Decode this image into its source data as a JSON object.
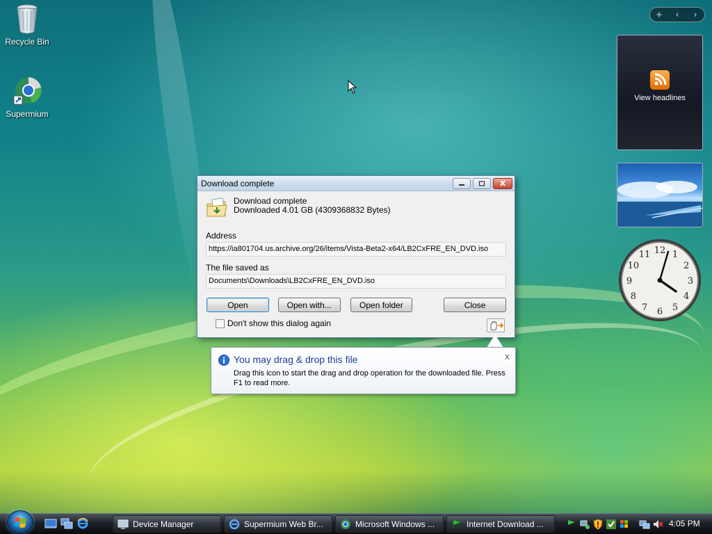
{
  "desktop": {
    "icons": [
      {
        "label": "Recycle Bin"
      },
      {
        "label": "Supermium"
      }
    ]
  },
  "sidebar": {
    "controls": {
      "add": "+",
      "prev": "‹",
      "next": "›"
    },
    "feed_gadget": {
      "title": "View headlines"
    },
    "clock": {
      "numerals": [
        "12",
        "1",
        "2",
        "3",
        "4",
        "5",
        "6",
        "7",
        "8",
        "9",
        "10",
        "11"
      ]
    }
  },
  "dialog": {
    "title": "Download complete",
    "message_line1": "Download complete",
    "message_line2": "Downloaded 4.01  GB (4309368832 Bytes)",
    "address_label": "Address",
    "address_value": "https://ia801704.us.archive.org/26/items/Vista-Beta2-x64/LB2CxFRE_EN_DVD.iso",
    "saved_label": "The file saved as",
    "saved_value": "Documents\\Downloads\\LB2CxFRE_EN_DVD.iso",
    "buttons": {
      "open": "Open",
      "open_with": "Open with...",
      "open_folder": "Open folder",
      "close": "Close"
    },
    "checkbox_label": "Don't show this dialog again"
  },
  "balloon": {
    "title": "You may drag & drop this file",
    "text": "Drag this icon to start the drag and drop operation for the downloaded file. Press F1 to read more.",
    "close": "x"
  },
  "taskbar": {
    "tasks": [
      {
        "label": "Device Manager"
      },
      {
        "label": "Supermium Web Br..."
      },
      {
        "label": "Microsoft Windows ..."
      },
      {
        "label": "Internet Download ..."
      }
    ],
    "clock": "4:05 PM"
  },
  "colors": {
    "balloon_title": "#1b3f9a",
    "taskbar": "#1d2228",
    "dialog_bg": "#f0f0f0"
  }
}
